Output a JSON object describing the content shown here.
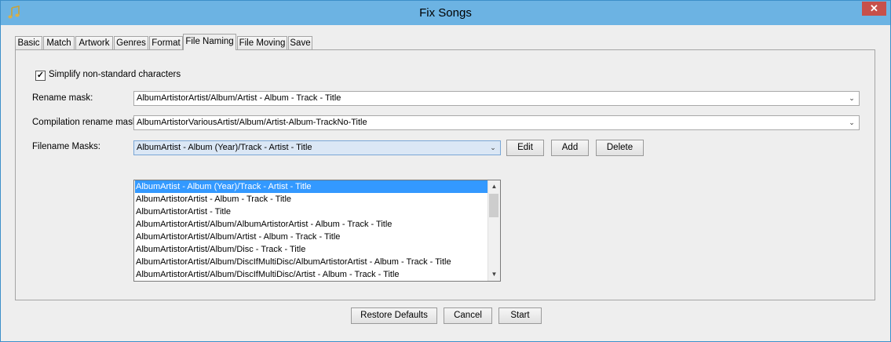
{
  "window": {
    "title": "Fix Songs",
    "close_glyph": "✕"
  },
  "tabs": [
    {
      "label": "Basic"
    },
    {
      "label": "Match"
    },
    {
      "label": "Artwork"
    },
    {
      "label": "Genres"
    },
    {
      "label": "Format"
    },
    {
      "label": "File Naming"
    },
    {
      "label": "File Moving"
    },
    {
      "label": "Save"
    }
  ],
  "active_tab": "File Naming",
  "file_naming": {
    "simplify": {
      "label": "Simplify non-standard characters",
      "checked": true,
      "glyph": "✓"
    },
    "rename_mask": {
      "label": "Rename mask:",
      "value": "AlbumArtistorArtist/Album/Artist - Album - Track - Title"
    },
    "compilation_mask": {
      "label": "Compilation rename mask:",
      "value": "AlbumArtistorVariousArtist/Album/Artist-Album-TrackNo-Title"
    },
    "filename_masks": {
      "label": "Filename Masks:",
      "value": "AlbumArtist - Album (Year)/Track - Artist - Title",
      "edit_label": "Edit",
      "add_label": "Add",
      "delete_label": "Delete",
      "options": [
        "AlbumArtist - Album (Year)/Track - Artist - Title",
        "AlbumArtistorArtist - Album - Track - Title",
        "AlbumArtistorArtist - Title",
        "AlbumArtistorArtist/Album/AlbumArtistorArtist - Album - Track - Title",
        "AlbumArtistorArtist/Album/Artist - Album - Track - Title",
        "AlbumArtistorArtist/Album/Disc - Track - Title",
        "AlbumArtistorArtist/Album/DiscIfMultiDisc/AlbumArtistorArtist - Album - Track - Title",
        "AlbumArtistorArtist/Album/DiscIfMultiDisc/Artist - Album - Track - Title"
      ],
      "selected_index": 0
    }
  },
  "footer": {
    "restore_label": "Restore Defaults",
    "cancel_label": "Cancel",
    "start_label": "Start"
  },
  "icons": {
    "combo_arrow": "⌄",
    "scroll_up": "▲",
    "scroll_down": "▼"
  }
}
